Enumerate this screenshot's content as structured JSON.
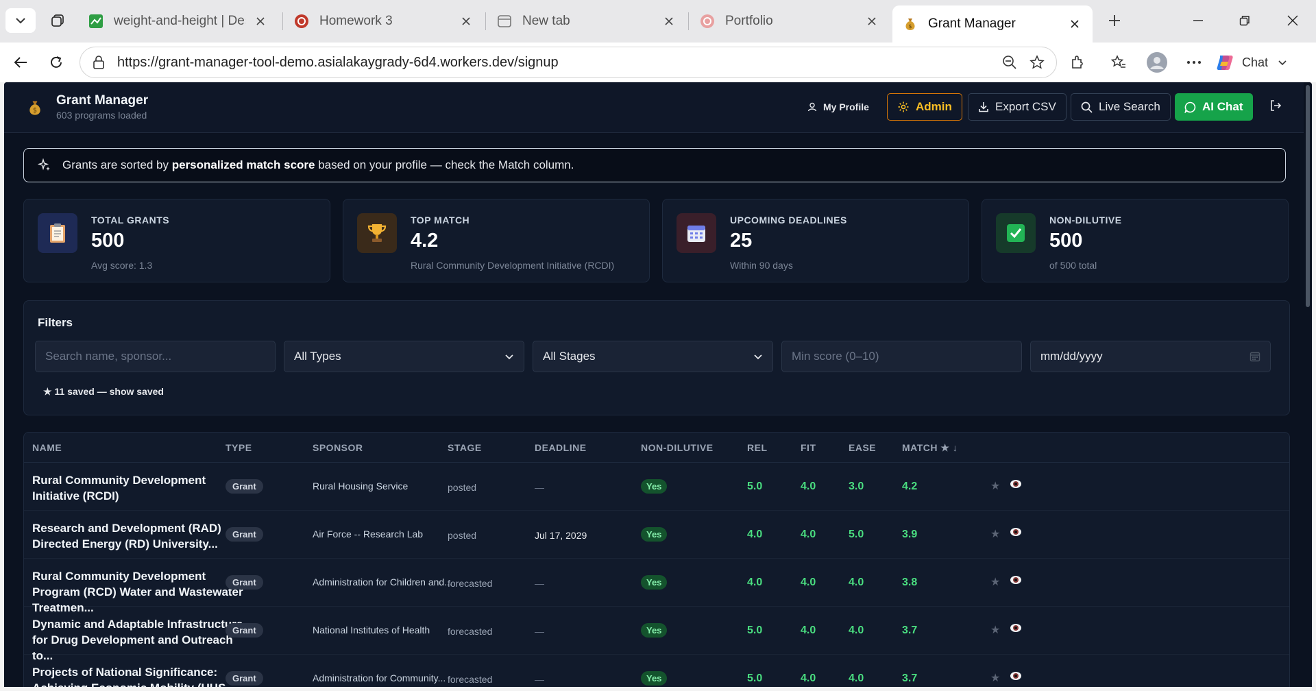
{
  "browser": {
    "tabs": [
      {
        "title": "weight-and-height | Desmos",
        "icon": "desmos-icon"
      },
      {
        "title": "Homework 3",
        "icon": "cornell-icon"
      },
      {
        "title": "New tab",
        "icon": "newtab-icon"
      },
      {
        "title": "Portfolio",
        "icon": "portfolio-icon"
      },
      {
        "title": "Grant Manager",
        "icon": "money-bag-icon",
        "active": true
      }
    ],
    "url": "https://grant-manager-tool-demo.asialakaygrady-6d4.workers.dev/signup",
    "chat_label": "Chat"
  },
  "header": {
    "title": "Grant Manager",
    "subtitle": "603 programs loaded",
    "buttons": {
      "profile": "My Profile",
      "admin": "Admin",
      "export": "Export CSV",
      "search": "Live Search",
      "chat": "AI Chat"
    }
  },
  "banner": {
    "prefix": "Grants are sorted by ",
    "bold": "personalized match score",
    "suffix": " based on your profile — check the Match column."
  },
  "stats": [
    {
      "label": "TOTAL GRANTS",
      "value": "500",
      "sub": "Avg score: 1.3",
      "icon": "clipboard-icon",
      "color": "#1e2a55"
    },
    {
      "label": "TOP MATCH",
      "value": "4.2",
      "sub": "Rural Community Development Initiative (RCDI)",
      "icon": "trophy-icon",
      "color": "#3a2a1a"
    },
    {
      "label": "UPCOMING DEADLINES",
      "value": "25",
      "sub": "Within 90 days",
      "icon": "calendar-icon",
      "color": "#3a1f2a"
    },
    {
      "label": "NON-DILUTIVE",
      "value": "500",
      "sub": "of 500 total",
      "icon": "check-icon",
      "color": "#163a2a"
    }
  ],
  "filters": {
    "title": "Filters",
    "search_placeholder": "Search name, sponsor...",
    "type_value": "All Types",
    "stage_value": "All Stages",
    "min_score_placeholder": "Min score (0–10)",
    "date_value": "mm/dd/yyyy",
    "saved_text": "★ 11 saved — show saved"
  },
  "table": {
    "headers": {
      "name": "NAME",
      "type": "TYPE",
      "sponsor": "SPONSOR",
      "stage": "STAGE",
      "deadline": "DEADLINE",
      "non_dilutive": "NON-DILUTIVE",
      "rel": "REL",
      "fit": "FIT",
      "ease": "EASE",
      "match": "MATCH ★ ↓"
    },
    "rows": [
      {
        "name": "Rural Community Development Initiative (RCDI)",
        "type": "Grant",
        "sponsor": "Rural Housing Service",
        "stage": "posted",
        "deadline": "—",
        "non_dilutive": "Yes",
        "rel": "5.0",
        "fit": "4.0",
        "ease": "3.0",
        "match": "4.2"
      },
      {
        "name": "Research and Development (RAD) Directed Energy (RD) University...",
        "type": "Grant",
        "sponsor": "Air Force -- Research Lab",
        "stage": "posted",
        "deadline": "Jul 17, 2029",
        "non_dilutive": "Yes",
        "rel": "4.0",
        "fit": "4.0",
        "ease": "5.0",
        "match": "3.9"
      },
      {
        "name": "Rural Community Development Program (RCD) Water and Wastewater Treatmen...",
        "type": "Grant",
        "sponsor": "Administration for Children and...",
        "stage": "forecasted",
        "deadline": "—",
        "non_dilutive": "Yes",
        "rel": "4.0",
        "fit": "4.0",
        "ease": "4.0",
        "match": "3.8"
      },
      {
        "name": "Dynamic and Adaptable Infrastructure for Drug Development and Outreach to...",
        "type": "Grant",
        "sponsor": "National Institutes of Health",
        "stage": "forecasted",
        "deadline": "—",
        "non_dilutive": "Yes",
        "rel": "5.0",
        "fit": "4.0",
        "ease": "4.0",
        "match": "3.7"
      },
      {
        "name": "Projects of National Significance: Achieving Economic Mobility (UHS...",
        "type": "Grant",
        "sponsor": "Administration for Community...",
        "stage": "forecasted",
        "deadline": "—",
        "non_dilutive": "Yes",
        "rel": "5.0",
        "fit": "4.0",
        "ease": "4.0",
        "match": "3.7"
      }
    ]
  }
}
